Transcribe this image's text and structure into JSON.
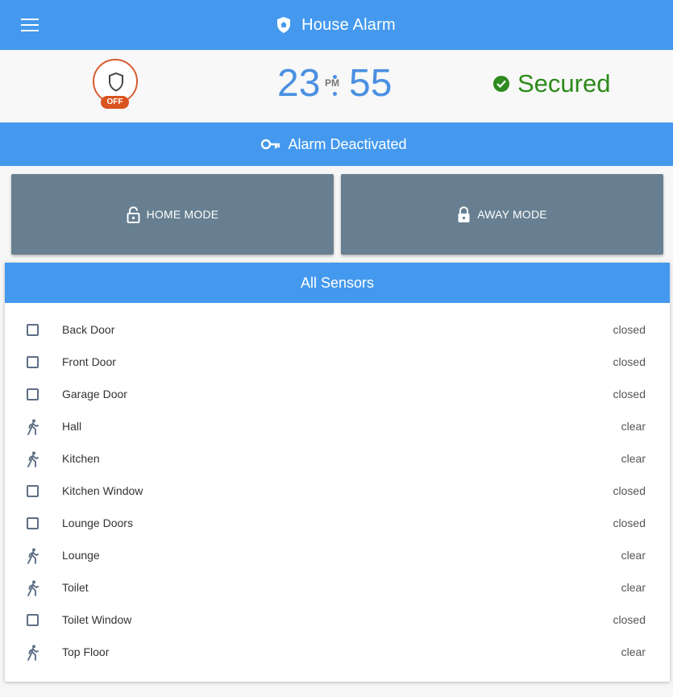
{
  "header": {
    "title": "House Alarm",
    "menu_icon": "menu-icon",
    "logo_icon": "shield-home-icon",
    "color": "#4499ee"
  },
  "status": {
    "alarm_state_badge": "OFF",
    "alarm_state_icon": "shield-outline-icon",
    "clock": {
      "hours": "23",
      "minutes": "55",
      "ampm": "PM"
    },
    "security_text": "Secured",
    "security_icon": "check-circle-icon",
    "security_color": "#2c8a1a"
  },
  "banner": {
    "text": "Alarm Deactivated",
    "icon": "key-icon"
  },
  "modes": {
    "home_label": "HOME MODE",
    "home_icon": "lock-open-icon",
    "away_label": "AWAY MODE",
    "away_icon": "lock-icon",
    "button_color": "#677f90"
  },
  "sensors": {
    "title": "All Sensors",
    "items": [
      {
        "name": "Back Door",
        "status": "closed",
        "icon": "checkbox-icon"
      },
      {
        "name": "Front Door",
        "status": "closed",
        "icon": "checkbox-icon"
      },
      {
        "name": "Garage Door",
        "status": "closed",
        "icon": "checkbox-icon"
      },
      {
        "name": "Hall",
        "status": "clear",
        "icon": "walking-person-icon"
      },
      {
        "name": "Kitchen",
        "status": "clear",
        "icon": "walking-person-icon"
      },
      {
        "name": "Kitchen Window",
        "status": "closed",
        "icon": "checkbox-icon"
      },
      {
        "name": "Lounge Doors",
        "status": "closed",
        "icon": "checkbox-icon"
      },
      {
        "name": "Lounge",
        "status": "clear",
        "icon": "walking-person-icon"
      },
      {
        "name": "Toilet",
        "status": "clear",
        "icon": "walking-person-icon"
      },
      {
        "name": "Toilet Window",
        "status": "closed",
        "icon": "checkbox-icon"
      },
      {
        "name": "Top Floor",
        "status": "clear",
        "icon": "walking-person-icon"
      }
    ]
  }
}
